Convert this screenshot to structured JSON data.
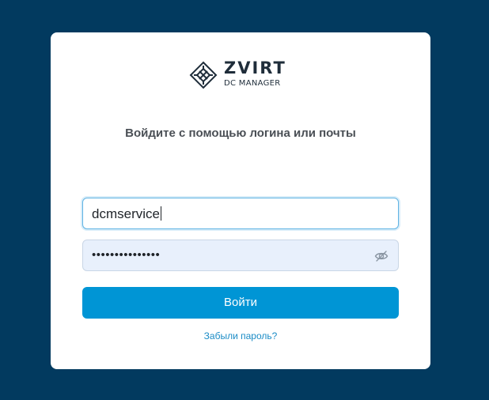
{
  "logo": {
    "brand": "ZVIRT",
    "subtitle": "DC MANAGER"
  },
  "login_form": {
    "heading": "Войдите с помощью логина или почты",
    "login_value": "dcmservice",
    "password_mask": "•••••••••••••••",
    "submit_label": "Войти",
    "forgot_link": "Забыли пароль?"
  },
  "icons": {
    "logo": "logo-icon",
    "password_toggle": "eye-slash-icon"
  },
  "colors": {
    "background": "#023a5f",
    "primary": "#0095d5",
    "link": "#1b8cc6",
    "input_focus": "#5fb3e3",
    "autofill": "#e8f0fc"
  }
}
